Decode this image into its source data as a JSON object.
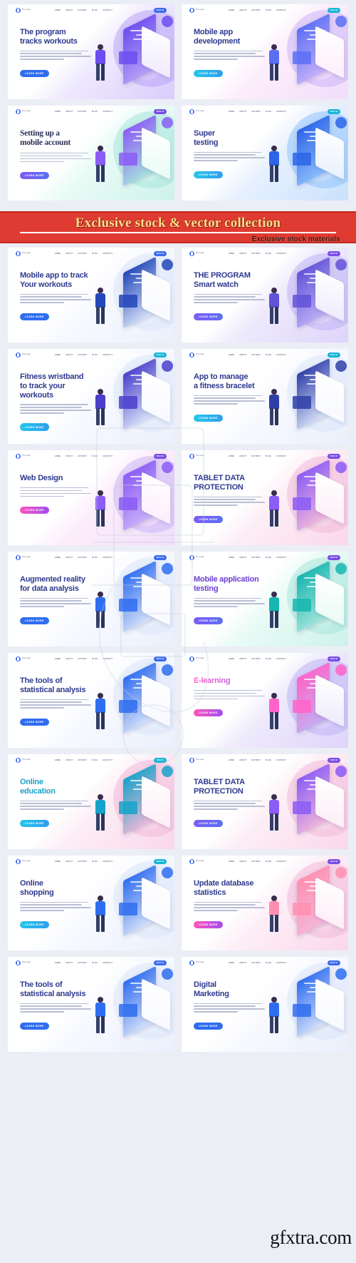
{
  "meta": {
    "watermark": "gfxtra.com"
  },
  "promo": {
    "title": "Exclusive stock & vector collection",
    "subtitle": "Exclusive stock materials",
    "bg_color": "#e03b32",
    "title_color": "#ffe08a",
    "rule_color": "#ffffff"
  },
  "nav": {
    "logo_text": "The Logo",
    "items": [
      "HOME",
      "ABOUT",
      "HISTORY",
      "BLOG",
      "CONTACT"
    ],
    "signin_label": "SIGN IN"
  },
  "common": {
    "cta_label": "LEARN MORE"
  },
  "cards": [
    {
      "id": "program-tracks-workouts",
      "title": "The program\ntracks workouts",
      "title_line1": "The program",
      "title_line2": "tracks workouts",
      "style": "bluegrad",
      "btn": "blue",
      "accent": "#6c4df0",
      "bg": "violet"
    },
    {
      "id": "mobile-app-development",
      "title_line1": "Mobile app",
      "title_line2": "development",
      "style": "bluegrad",
      "btn": "cyan",
      "accent": "#5b6ff5",
      "bg": "pinkviolet"
    },
    {
      "id": "setting-up-a-mobile-account",
      "title_line1": "Setting up a",
      "title_line2": "mobile account",
      "style": "serif",
      "btn": "violet",
      "accent": "#8b5cf6",
      "bg": "teal"
    },
    {
      "id": "super-testing",
      "title_line1": "Super",
      "title_line2": "testing",
      "style": "bluegrad",
      "btn": "cyan",
      "accent": "#2d64e8",
      "bg": "blue"
    },
    {
      "id": "mobile-app-to-track-your-workouts",
      "title_line1": "Mobile app to track",
      "title_line2": "Your workouts",
      "style": "bluegrad",
      "btn": "blue",
      "accent": "#2347b8",
      "bg": "white"
    },
    {
      "id": "the-program-smart-watch",
      "title_line1": "THE PROGRAM",
      "title_line2": "Smart watch",
      "style": "bluegrad",
      "btn": "violet",
      "accent": "#6152d8",
      "bg": "lavender"
    },
    {
      "id": "fitness-wristband-to-track-your-workouts",
      "title_line1": "Fitness wristband",
      "title_line2": "to track your",
      "title_line3": "workouts",
      "style": "bluegrad",
      "btn": "cyan",
      "accent": "#4a3ecb",
      "bg": "white"
    },
    {
      "id": "app-to-manage-a-fitness-bracelet",
      "title_line1": "App to manage",
      "title_line2": "a fitness bracelet",
      "style": "bluegrad",
      "btn": "cyan",
      "accent": "#2f3fa8",
      "bg": "white"
    },
    {
      "id": "web-design",
      "title_line1": "Web Design",
      "title_line2": "",
      "style": "bluegrad",
      "btn": "pink",
      "accent": "#8b5cf6",
      "bg": "pinkviolet"
    },
    {
      "id": "tablet-data-protection-1",
      "title_line1": "TABLET DATA",
      "title_line2": "PROTECTION",
      "style": "bluegrad",
      "btn": "violet",
      "accent": "#8b5cf6",
      "bg": "pink"
    },
    {
      "id": "augmented-reality-for-data-analysis",
      "title_line1": "Augmented reality",
      "title_line2": "for data analysis",
      "style": "bluegrad",
      "btn": "blue",
      "accent": "#2f6df0",
      "bg": "white"
    },
    {
      "id": "mobile-application-testing",
      "title_line1": "Mobile application",
      "title_line2": "testing",
      "style": "violet",
      "btn": "violet",
      "accent": "#17b6b0",
      "bg": "teal"
    },
    {
      "id": "the-tools-of-statistical-analysis-1",
      "title_line1": "The tools of",
      "title_line2": "statistical analysis",
      "style": "bluegrad",
      "btn": "blue",
      "accent": "#2f6df0",
      "bg": "white"
    },
    {
      "id": "e-learning",
      "title_line1": "E-learning",
      "title_line2": "",
      "style": "pinkgrad",
      "btn": "pink",
      "accent": "#ff63c8",
      "bg": "lavender"
    },
    {
      "id": "online-education",
      "title_line1": "Online",
      "title_line2": "education",
      "style": "cyan",
      "btn": "cyan",
      "accent": "#17a3c9",
      "bg": "pink"
    },
    {
      "id": "tablet-data-protection-2",
      "title_line1": "TABLET DATA",
      "title_line2": "PROTECTION",
      "style": "bluegrad",
      "btn": "violet",
      "accent": "#8b5cf6",
      "bg": "pink"
    },
    {
      "id": "online-shopping",
      "title_line1": "Online",
      "title_line2": "shopping",
      "style": "bluegrad",
      "btn": "cyan",
      "accent": "#2f6df0",
      "bg": "white"
    },
    {
      "id": "update-database-statistics",
      "title_line1": "Update database",
      "title_line2": "statistics",
      "style": "bluegrad",
      "btn": "pink",
      "accent": "#ff8fb0",
      "bg": "pink"
    },
    {
      "id": "the-tools-of-statistical-analysis-2",
      "title_line1": "The tools of",
      "title_line2": "statistical analysis",
      "style": "bluegrad",
      "btn": "blue",
      "accent": "#2f6df0",
      "bg": "white"
    },
    {
      "id": "digital-marketing",
      "title_line1": "Digital",
      "title_line2": "Marketing",
      "style": "bluegrad",
      "btn": "blue",
      "accent": "#2f6df0",
      "bg": "white"
    }
  ]
}
